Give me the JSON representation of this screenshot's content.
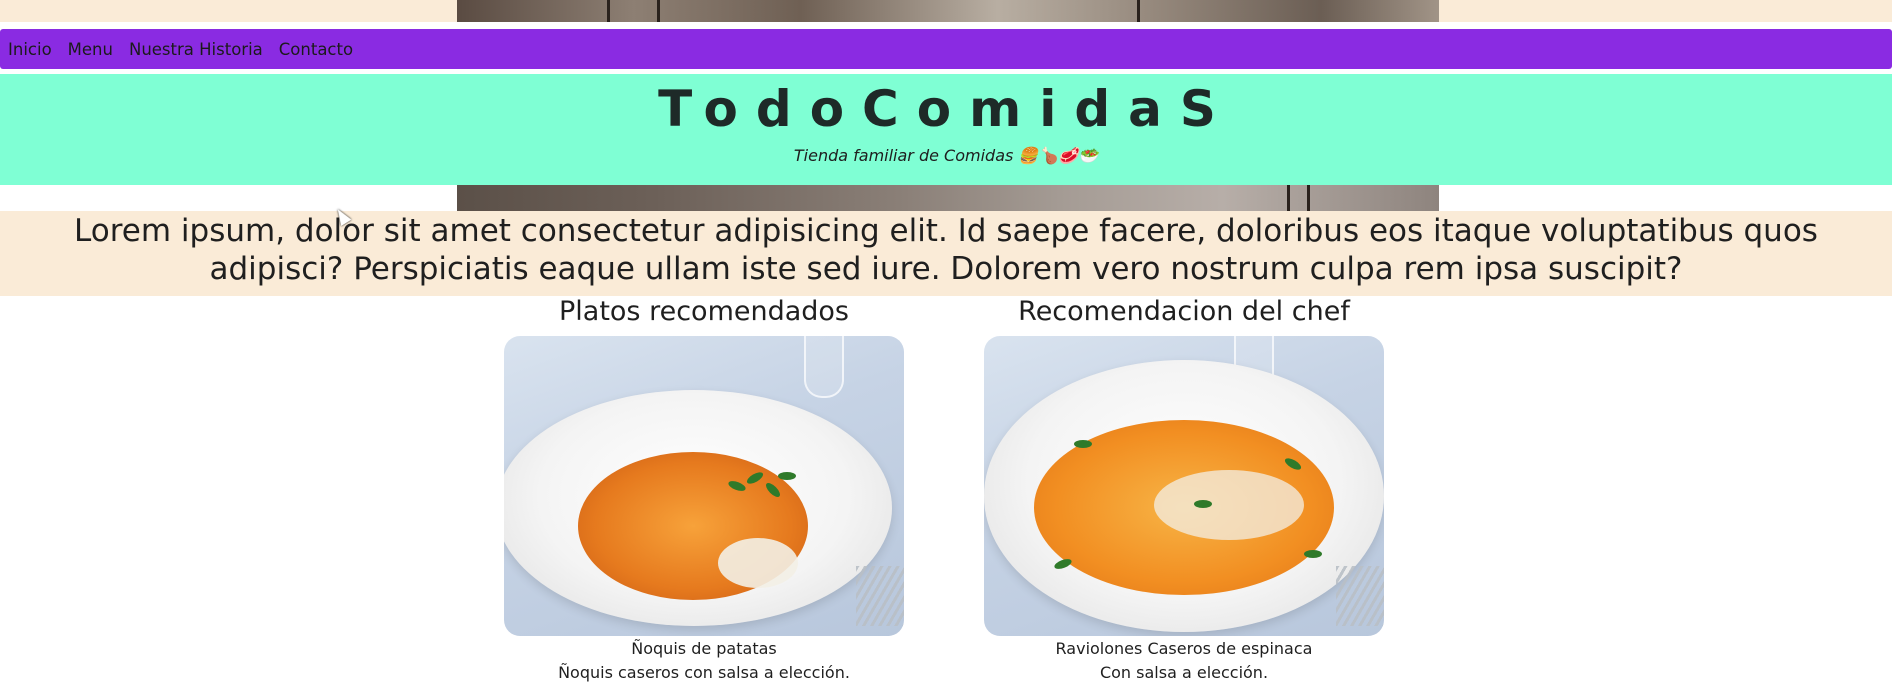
{
  "nav": {
    "items": [
      {
        "label": "Inicio"
      },
      {
        "label": "Menu"
      },
      {
        "label": "Nuestra Historia"
      },
      {
        "label": "Contacto"
      }
    ]
  },
  "header": {
    "brand": "TodoComidaS",
    "tagline": "Tienda familiar de Comidas 🍔🍗🥩🥗"
  },
  "intro": {
    "text": "Lorem ipsum, dolor sit amet consectetur adipisicing elit. Id saepe facere, doloribus eos itaque voluptatibus quos adipisci? Perspiciatis eaque ullam iste sed iure. Dolorem vero nostrum culpa rem ipsa suscipit?"
  },
  "cards": [
    {
      "title": "Platos recomendados",
      "name": "Ñoquis de patatas",
      "description": "Ñoquis caseros con salsa a elección."
    },
    {
      "title": "Recomendacion del chef",
      "name": "Raviolones Caseros de espinaca",
      "description": "Con salsa a elección."
    }
  ],
  "colors": {
    "nav_bg": "#8a2be2",
    "header_bg": "#7fffd4",
    "intro_bg": "#faebd7"
  }
}
